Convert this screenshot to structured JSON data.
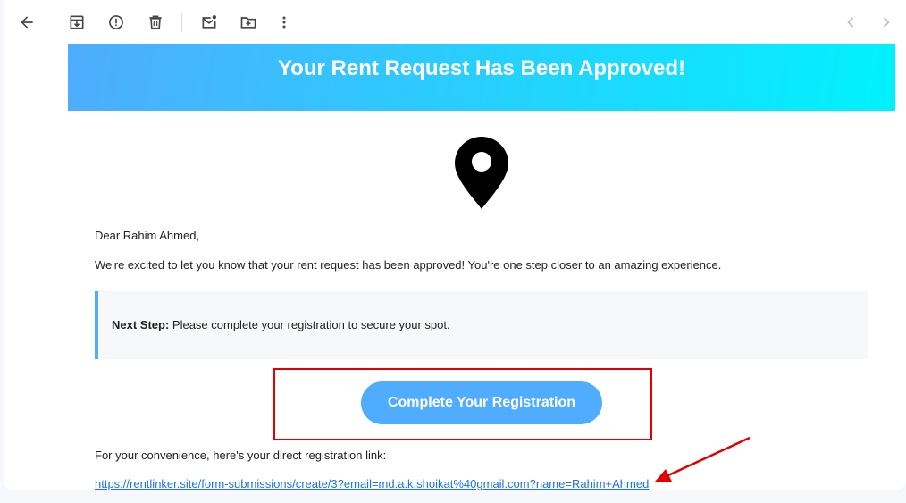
{
  "toolbar": {
    "icons": [
      "back-arrow-icon",
      "archive-icon",
      "report-spam-icon",
      "delete-icon",
      "mark-unread-icon",
      "move-to-icon",
      "more-options-icon",
      "older-chevron-icon",
      "newer-chevron-icon"
    ]
  },
  "email": {
    "banner_title": "Your Rent Request Has Been Approved!",
    "greeting": "Dear Rahim Ahmed,",
    "intro": "We're excited to let you know that your rent request has been approved! You're one step closer to an amazing experience.",
    "next_step_label": "Next Step:",
    "next_step_text": " Please complete your registration to secure your spot.",
    "cta_label": "Complete Your Registration",
    "convenience_text": "For your convenience, here's your direct registration link:",
    "link": "https://rentlinker.site/form-submissions/create/3?email=md.a.k.shoikat%40gmail.com?name=Rahim+Ahmed"
  },
  "colors": {
    "banner_start": "#4facfe",
    "banner_end": "#00f2fe",
    "button": "#4facfe",
    "annotation": "#e40000",
    "link": "#1a73e8"
  }
}
